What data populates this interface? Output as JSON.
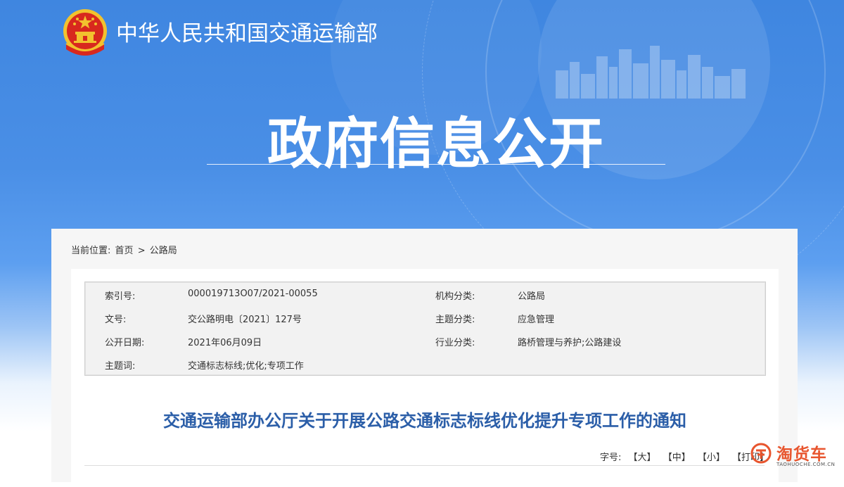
{
  "header": {
    "ministry_name": "中华人民共和国交通运输部",
    "section_title": "政府信息公开"
  },
  "breadcrumb": {
    "label": "当前位置:",
    "home": "首页",
    "separator": ">",
    "current": "公路局"
  },
  "meta": {
    "rows": [
      {
        "k1": "索引号:",
        "v1": "000019713O07/2021-00055",
        "k2": "机构分类:",
        "v2": "公路局"
      },
      {
        "k1": "文号:",
        "v1": "交公路明电〔2021〕127号",
        "k2": "主题分类:",
        "v2": "应急管理"
      },
      {
        "k1": "公开日期:",
        "v1": "2021年06月09日",
        "k2": "行业分类:",
        "v2": "路桥管理与养护;公路建设"
      },
      {
        "k1": "主题词:",
        "v1": "交通标志标线;优化;专项工作",
        "k2": "",
        "v2": ""
      }
    ]
  },
  "document": {
    "title": "交通运输部办公厅关于开展公路交通标志标线优化提升专项工作的通知"
  },
  "font_size": {
    "label": "字号:",
    "large": "【大】",
    "medium": "【中】",
    "small": "【小】",
    "print": "【打印】"
  },
  "watermark": {
    "brand": "淘货车",
    "url": "TAOHUOCHE.COM.CN"
  },
  "colors": {
    "banner_blue": "#3f86e0",
    "title_blue": "#2b5ea8",
    "watermark_orange": "#e8552e",
    "emblem_red": "#d8281e",
    "emblem_gold": "#f2c22e"
  }
}
